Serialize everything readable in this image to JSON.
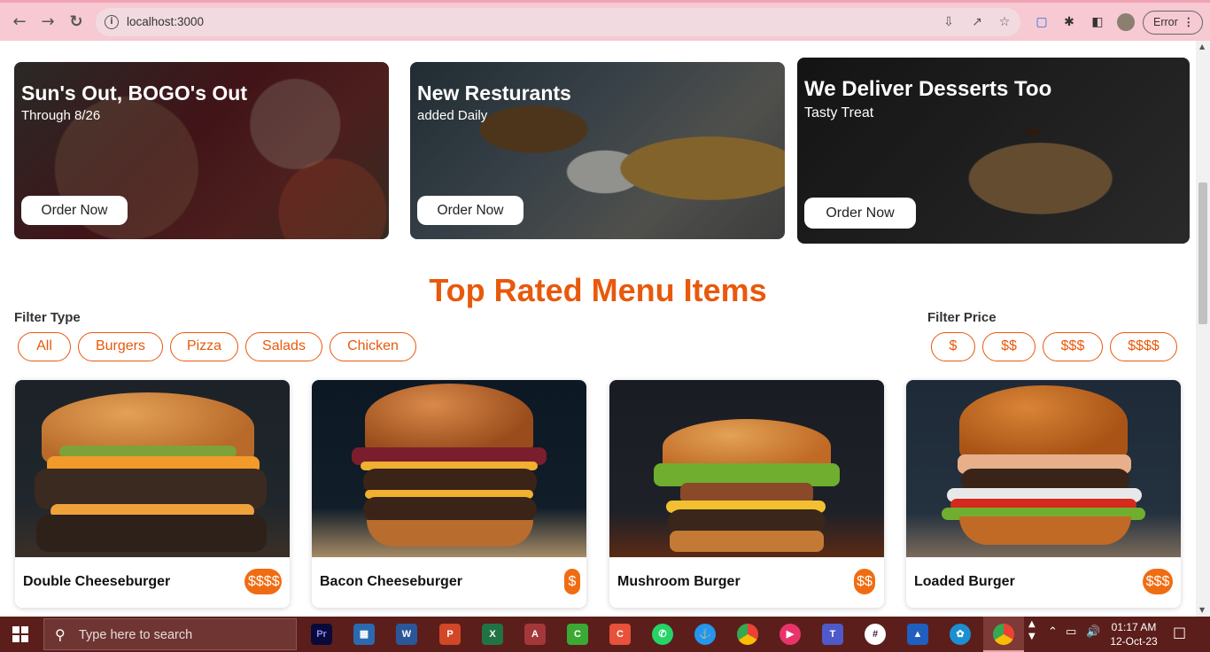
{
  "browser": {
    "url": "localhost:3000",
    "error_label": "Error"
  },
  "promos": [
    {
      "title": "Sun's Out, BOGO's Out",
      "subtitle": "Through 8/26",
      "button": "Order Now"
    },
    {
      "title": "New Resturants",
      "subtitle": "added Daily",
      "button": "Order Now"
    },
    {
      "title": "We Deliver Desserts Too",
      "subtitle": "Tasty Treat",
      "button": "Order Now"
    }
  ],
  "menu": {
    "title": "Top Rated Menu Items",
    "filter_type_label": "Filter Type",
    "filter_types": [
      "All",
      "Burgers",
      "Pizza",
      "Salads",
      "Chicken"
    ],
    "filter_price_label": "Filter Price",
    "filter_prices": [
      "$",
      "$$",
      "$$$",
      "$$$$"
    ],
    "items": [
      {
        "name": "Double Cheeseburger",
        "price": "$$$$"
      },
      {
        "name": "Bacon Cheeseburger",
        "price": "$"
      },
      {
        "name": "Mushroom Burger",
        "price": "$$"
      },
      {
        "name": "Loaded Burger",
        "price": "$$$"
      }
    ]
  },
  "taskbar": {
    "search_placeholder": "Type here to search",
    "time": "01:17 AM",
    "date": "12-Oct-23"
  },
  "colors": {
    "accent": "#e8590c",
    "price_badge": "#f06c13",
    "taskbar": "#5b1e1b",
    "chrome": "#f7c9d2"
  }
}
